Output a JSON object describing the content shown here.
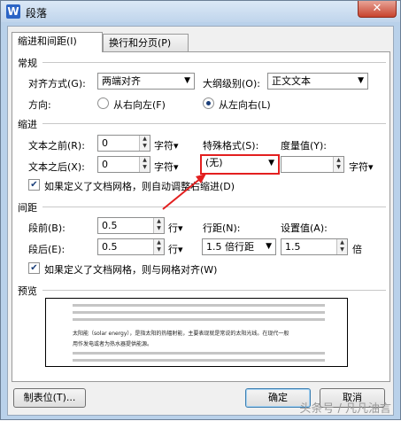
{
  "window": {
    "title": "段落",
    "app_icon_letter": "W",
    "close_glyph": "✕"
  },
  "tabs": [
    {
      "label": "缩进和间距(I)"
    },
    {
      "label": "换行和分页(P)"
    }
  ],
  "general": {
    "section": "常规",
    "alignment_label": "对齐方式(G):",
    "alignment_value": "两端对齐",
    "outline_label": "大纲级别(O):",
    "outline_value": "正文文本",
    "direction_label": "方向:",
    "rtl_label": "从右向左(F)",
    "ltr_label": "从左向右(L)"
  },
  "indent": {
    "section": "缩进",
    "before_label": "文本之前(R):",
    "before_value": "0",
    "before_unit": "字符▾",
    "after_label": "文本之后(X):",
    "after_value": "0",
    "after_unit": "字符▾",
    "special_label": "特殊格式(S):",
    "special_value": "(无)",
    "measure_label": "度量值(Y):",
    "measure_value": "",
    "measure_unit": "字符▾",
    "grid_check_label": "如果定义了文档网格，则自动调整右缩进(D)"
  },
  "spacing": {
    "section": "间距",
    "before_label": "段前(B):",
    "before_value": "0.5",
    "before_unit": "行▾",
    "after_label": "段后(E):",
    "after_value": "0.5",
    "after_unit": "行▾",
    "line_label": "行距(N):",
    "line_value": "1.5 倍行距",
    "setting_label": "设置值(A):",
    "setting_value": "1.5",
    "setting_unit": "倍",
    "grid_check_label": "如果定义了文档网格，则与网格对齐(W)"
  },
  "preview": {
    "section": "预览",
    "sample_line1": "太阳能（solar energy），是指太阳的热辐射能，主要表现就是常说的太阳光线。在现代一般",
    "sample_line2": "用作发电或者为热水器提供能源。"
  },
  "buttons": {
    "tabs_label": "制表位(T)...",
    "ok_label": "确定",
    "cancel_label": "取消"
  },
  "watermark": "头条号 / 凡凡油言"
}
